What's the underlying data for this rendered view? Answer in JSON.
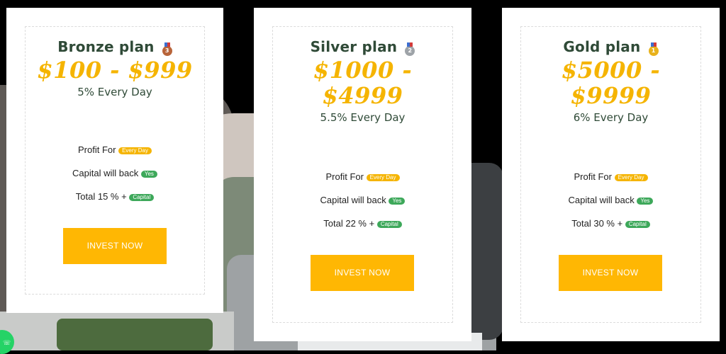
{
  "plans": [
    {
      "title": "Bronze plan",
      "medal": "bronze-medal-icon",
      "price_line1": "$100 - $999",
      "price_line2": "",
      "rate": "5% Every Day",
      "profit_label": "Profit For",
      "profit_badge": "Every Day",
      "capital_label": "Capital will back",
      "capital_badge": "Yes",
      "total_label": "Total 15 % +",
      "total_badge": "Capital",
      "button_label": "INVEST NOW"
    },
    {
      "title": "Silver plan",
      "medal": "silver-medal-icon",
      "price_line1": "$1000 -",
      "price_line2": "$4999",
      "rate": "5.5% Every Day",
      "profit_label": "Profit For",
      "profit_badge": "Every Day",
      "capital_label": "Capital will back",
      "capital_badge": "Yes",
      "total_label": "Total 22 % +",
      "total_badge": "Capital",
      "button_label": "INVEST NOW"
    },
    {
      "title": "Gold plan",
      "medal": "gold-medal-icon",
      "price_line1": "$5000 -",
      "price_line2": "$9999",
      "rate": "6% Every Day",
      "profit_label": "Profit For",
      "profit_badge": "Every Day",
      "capital_label": "Capital will back",
      "capital_badge": "Yes",
      "total_label": "Total 30 % +",
      "total_badge": "Capital",
      "button_label": "INVEST NOW"
    }
  ],
  "colors": {
    "accent": "#ffb703",
    "price": "#f5b400",
    "title": "#2f4a37",
    "badge_green": "#3da85a"
  },
  "floating_button_icon": "whatsapp-icon"
}
